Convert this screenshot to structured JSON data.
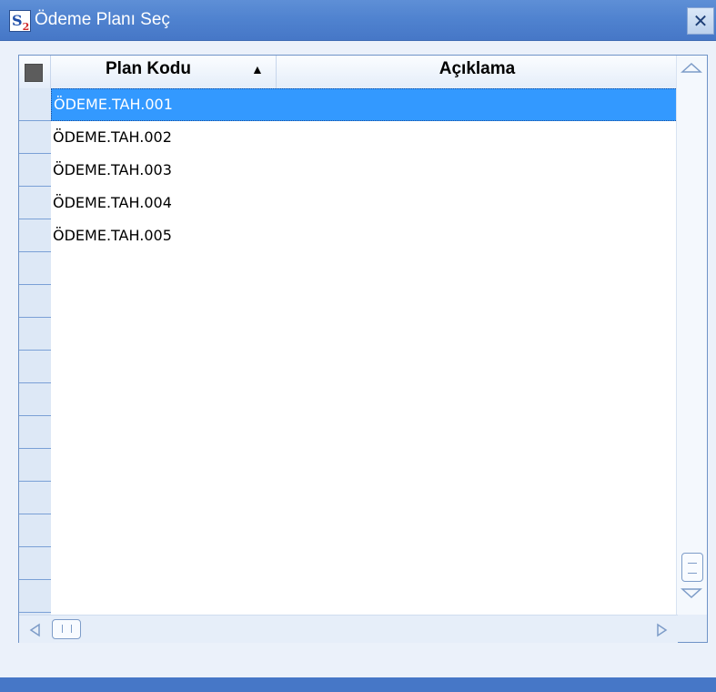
{
  "window": {
    "title": "Ödeme Planı Seç",
    "icon_text": "S",
    "icon_sub": "2",
    "close_label": "✕"
  },
  "grid": {
    "columns": [
      {
        "label": "Plan Kodu",
        "sort": "ascending"
      },
      {
        "label": "Açıklama"
      }
    ],
    "rows": [
      {
        "code": "ÖDEME.TAH.001",
        "description": "",
        "selected": true
      },
      {
        "code": "ÖDEME.TAH.002",
        "description": ""
      },
      {
        "code": "ÖDEME.TAH.003",
        "description": ""
      },
      {
        "code": "ÖDEME.TAH.004",
        "description": ""
      },
      {
        "code": "ÖDEME.TAH.005",
        "description": ""
      }
    ]
  },
  "colors": {
    "titlebar": "#4f82cf",
    "selection": "#3399ff",
    "row_indicator": "#dde8f6"
  },
  "icons": {
    "sort": "sort-ascending-icon",
    "select_all": "select-all-icon",
    "close": "close-icon"
  }
}
